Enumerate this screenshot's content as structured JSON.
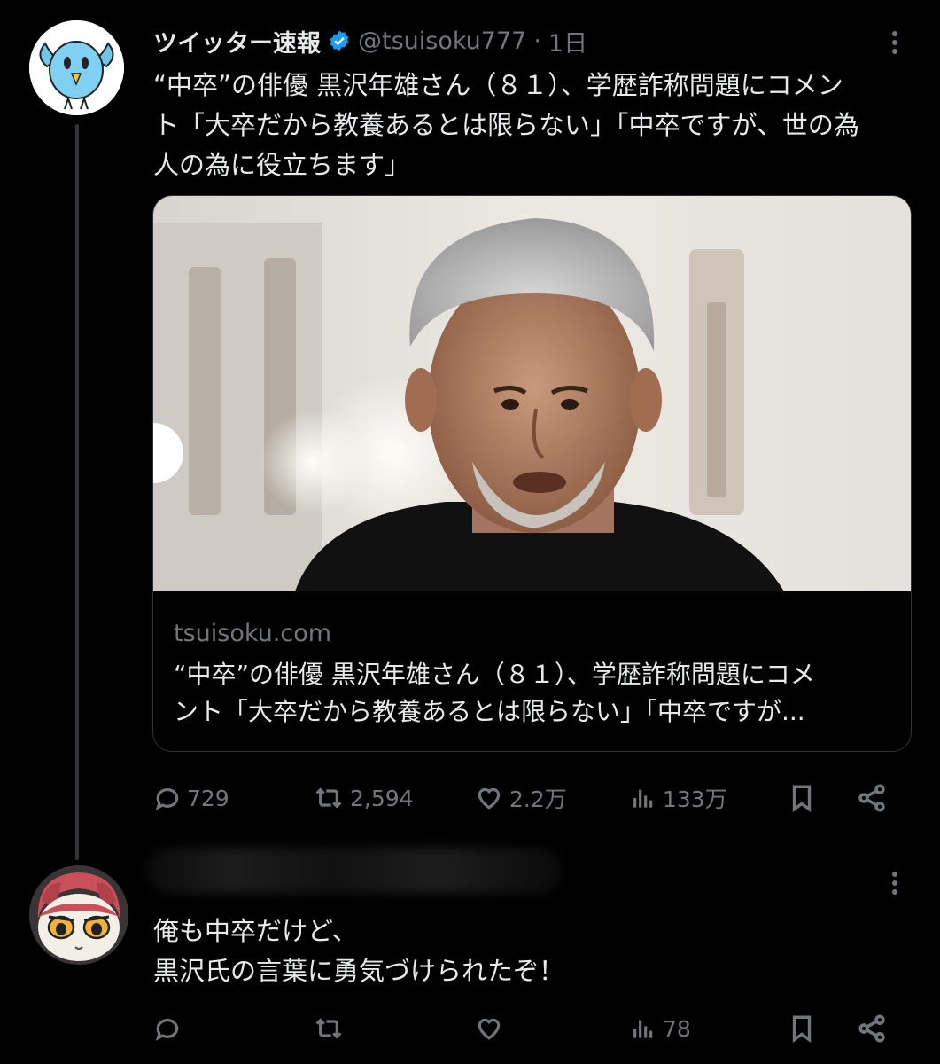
{
  "tweet": {
    "display_name": "ツイッター速報",
    "handle": "@tsuisoku777",
    "separator": "·",
    "time": "1日",
    "text_lines": [
      "“中卒”の俳優 黒沢年雄さん（８１）、学歴詐称問題にコメン",
      "ト「大卒だから教養あるとは限らない」「中卒ですが、世の為",
      "人の為に役立ちます」"
    ],
    "card": {
      "domain": "tsuisoku.com",
      "title_lines": [
        "“中卒”の俳優 黒沢年雄さん（８１）、学歴詐称問題にコメ",
        "ント「大卒だから教養あるとは限らない」「中卒ですが..."
      ]
    },
    "stats": {
      "replies": "729",
      "retweets": "2,594",
      "likes": "2.2万",
      "views": "133万"
    }
  },
  "reply": {
    "text_lines": [
      "俺も中卒だけど、",
      "黒沢氏の言葉に勇気づけられたぞ！"
    ],
    "stats": {
      "views": "78"
    }
  },
  "colors": {
    "background": "#000000",
    "text": "#e7e9ea",
    "muted": "#71767b",
    "verified": "#1d9bf0",
    "border": "#2f3336"
  }
}
